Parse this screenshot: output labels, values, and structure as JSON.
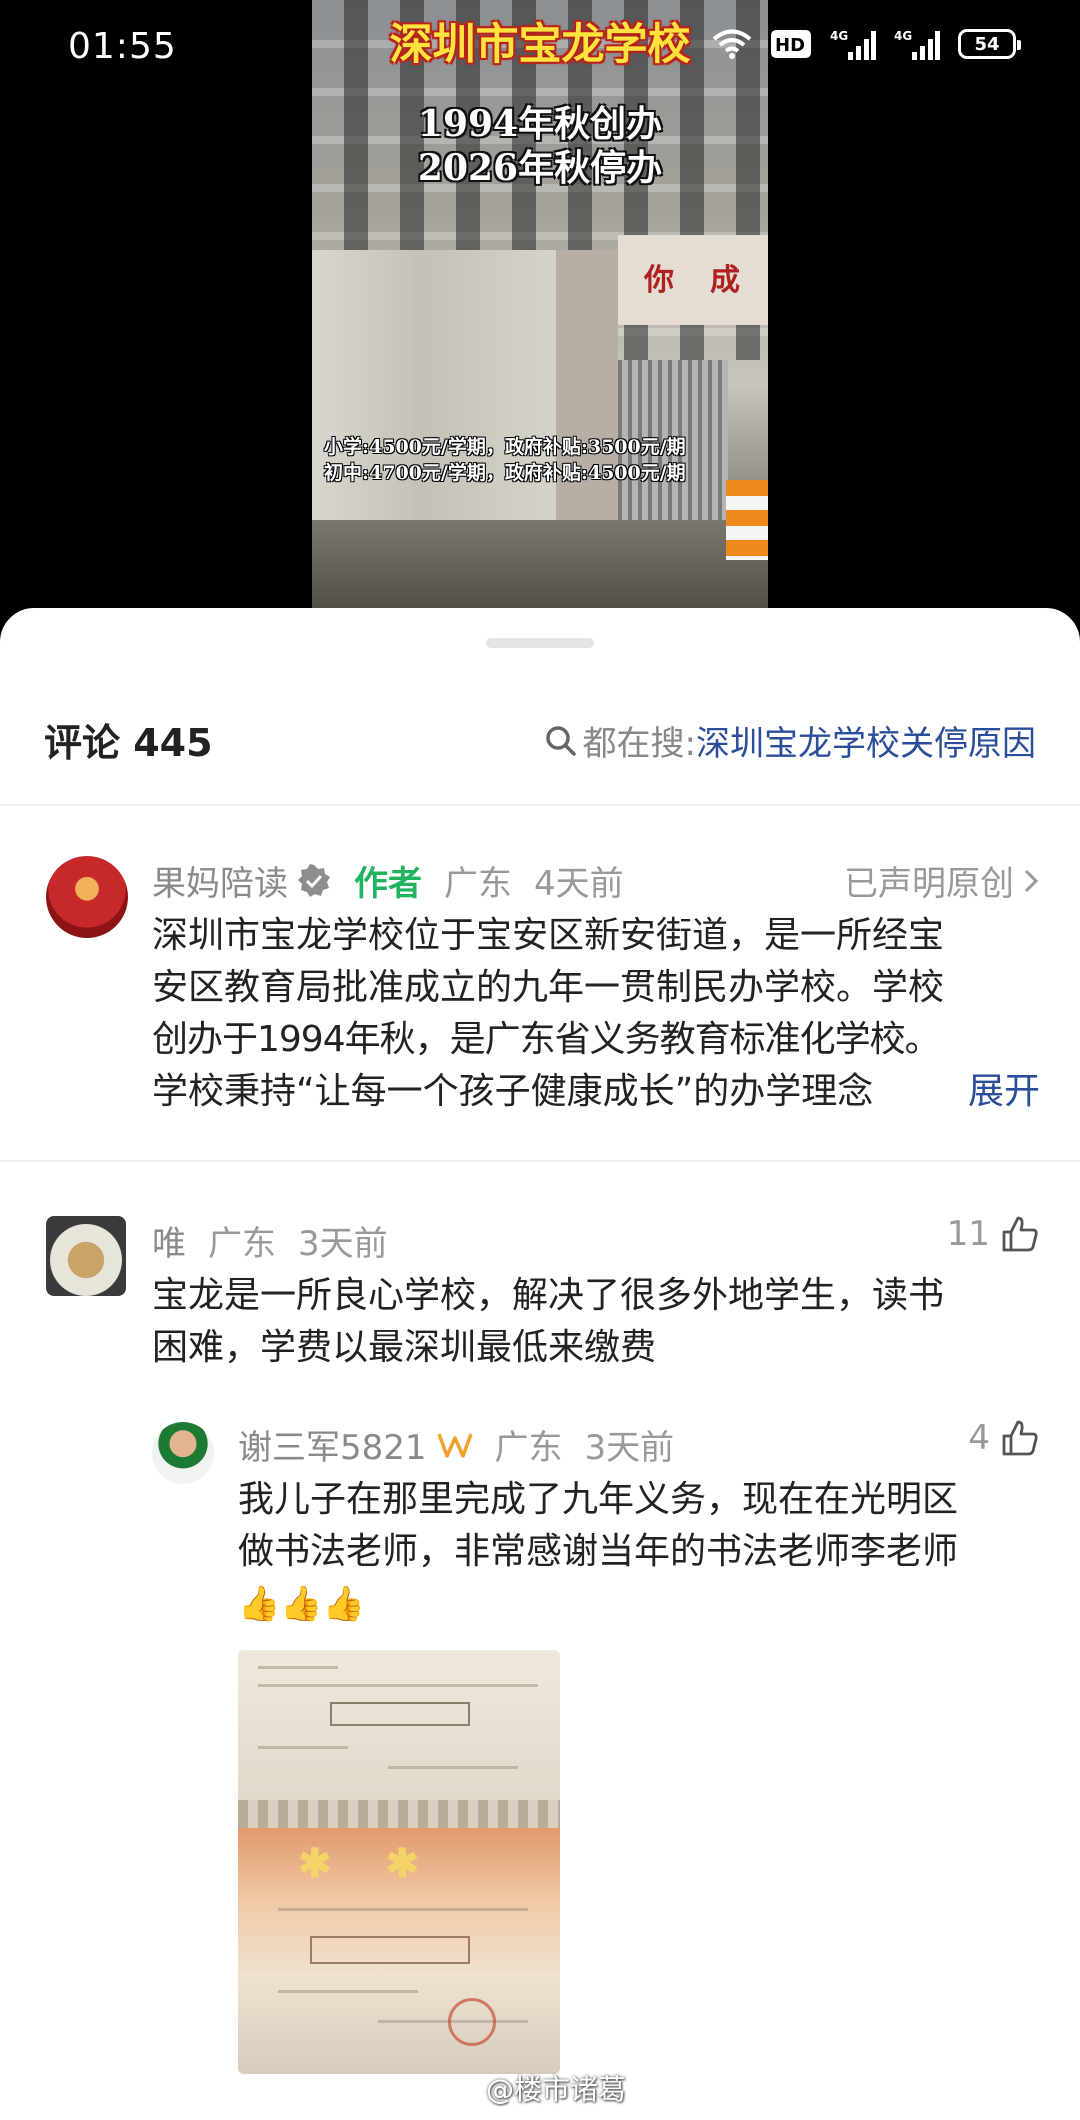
{
  "status_bar": {
    "time": "01:55",
    "hd_label": "HD",
    "net1": "4G",
    "net2": "4G",
    "battery": "54"
  },
  "video": {
    "title": "深圳市宝龙学校",
    "line1": "1994年秋创办",
    "line2": "2026年秋停办",
    "fee1": "小学:4500元/学期，政府补贴:3500元/期",
    "fee2": "初中:4700元/学期，政府补贴:4500元/期",
    "sign_chars": [
      "你",
      "成"
    ]
  },
  "comments_header": {
    "title": "评论 445",
    "search_label": "都在搜:",
    "search_keyword": "深圳宝龙学校关停原因"
  },
  "comments": [
    {
      "name": "果妈陪读",
      "tag": "作者",
      "location": "广东",
      "time": "4天前",
      "claim": "已声明原创",
      "lines": [
        "深圳市宝龙学校位于宝安区新安街道，是一所经宝",
        "安区教育局批准成立的九年一贯制民办学校。学校",
        "创办于1994年秋，是广东省义务教育标准化学校。",
        "学校秉持“让每一个孩子健康成长”的办学理念"
      ],
      "expand": "展开"
    },
    {
      "name": "唯",
      "location": "广东",
      "time": "3天前",
      "likes": "11",
      "lines": [
        "宝龙是一所良心学校，解决了很多外地学生，读书",
        "困难，学费以最深圳最低来缴费"
      ]
    },
    {
      "name": "谢三军5821",
      "location": "广东",
      "time": "3天前",
      "likes": "4",
      "lines": [
        "我儿子在那里完成了九年义务，现在在光明区",
        "做书法老师，非常感谢当年的书法老师李老师",
        "👍👍👍"
      ]
    }
  ],
  "watermark": "@楼市诸葛",
  "icons": {
    "search": "search-icon",
    "verified": "verified-badge-icon",
    "chevron": "chevron-right-icon",
    "like": "thumbs-up-icon",
    "vip": "vip-badge-icon",
    "weibo": "weibo-logo-icon"
  }
}
